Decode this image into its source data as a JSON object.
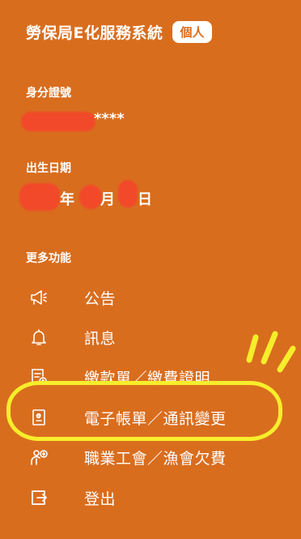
{
  "header": {
    "title": "勞保局E化服務系統",
    "badge": "個人"
  },
  "id_field": {
    "label": "身分證號",
    "masked_suffix": "****"
  },
  "birth_field": {
    "label": "出生日期",
    "year_char": "年",
    "month_char": "月",
    "day_char": "日"
  },
  "more_functions": {
    "title": "更多功能"
  },
  "menu": {
    "items": [
      {
        "label": "公告",
        "icon": "megaphone-icon"
      },
      {
        "label": "訊息",
        "icon": "bell-icon"
      },
      {
        "label": "繳款單／繳費證明",
        "icon": "payment-receipt-icon"
      },
      {
        "label": "電子帳單／通訊變更",
        "icon": "e-bill-icon"
      },
      {
        "label": "職業工會／漁會欠費",
        "icon": "union-dues-icon"
      },
      {
        "label": "登出",
        "icon": "logout-icon"
      }
    ]
  },
  "colors": {
    "background": "#D96D1E",
    "text": "#FFFFFF",
    "annotation": "#F7EE2B",
    "redaction": "#F2492A"
  }
}
